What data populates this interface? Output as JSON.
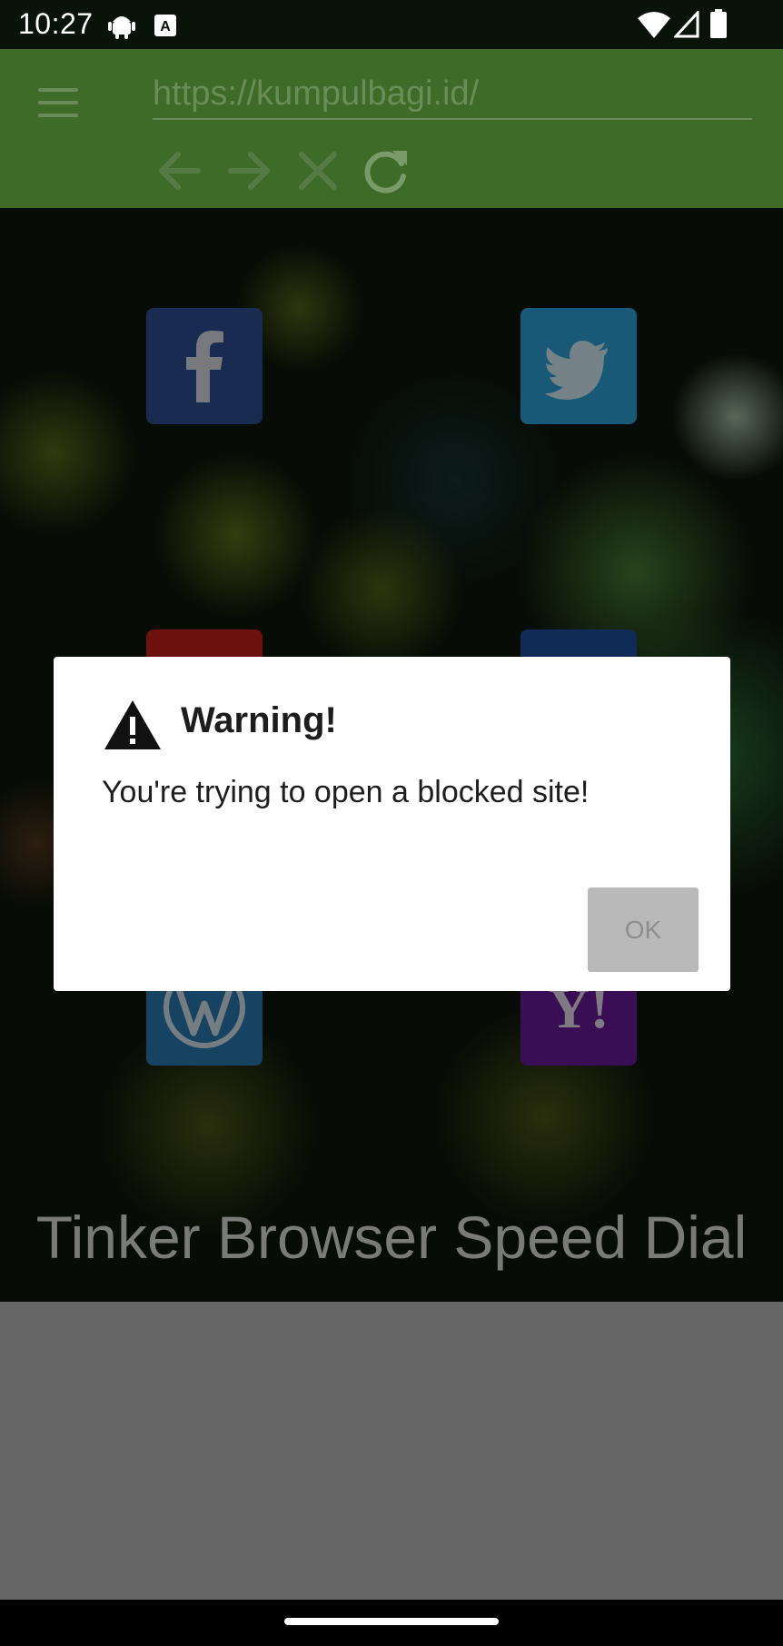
{
  "status_bar": {
    "time": "10:27",
    "icons": [
      "android-icon",
      "a-badge-icon",
      "wifi-icon",
      "signal-icon",
      "battery-icon"
    ]
  },
  "toolbar": {
    "url": "https://kumpulbagi.id/",
    "buttons": [
      "back-arrow-icon",
      "forward-arrow-icon",
      "close-icon",
      "refresh-icon"
    ],
    "color": "#3e6b28"
  },
  "speed_dial": {
    "title": "Tinker Browser Speed Dial",
    "tiles": [
      {
        "name": "facebook",
        "glyph": "f",
        "color": "#2f4f93"
      },
      {
        "name": "twitter",
        "glyph": "",
        "color": "#2aa3d8"
      },
      {
        "name": "youtube",
        "glyph": "",
        "color": "#c6201d"
      },
      {
        "name": "unknown-blue",
        "glyph": "",
        "color": "#1f4fa0"
      },
      {
        "name": "wordpress",
        "glyph": "W",
        "color": "#2a7bb5"
      },
      {
        "name": "yahoo",
        "glyph": "Y!",
        "color": "#6a1b9a"
      }
    ]
  },
  "dialog": {
    "title": "Warning!",
    "message": "You're trying to open a blocked site!",
    "ok_label": "OK"
  }
}
